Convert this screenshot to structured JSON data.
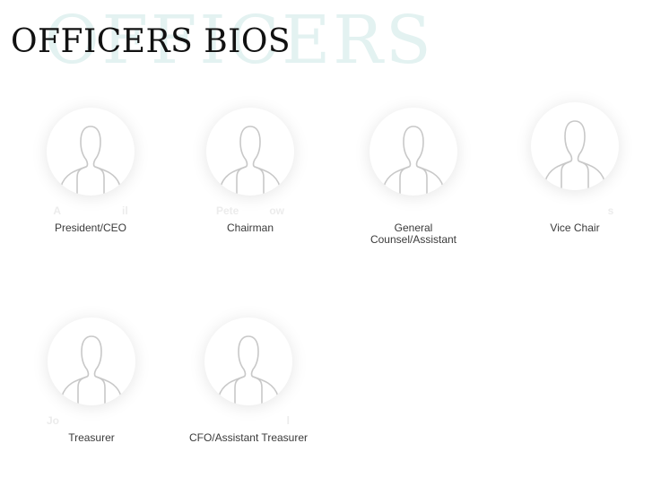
{
  "page": {
    "watermark": "OFFICERS",
    "heading": "OFFICERS BIOS"
  },
  "officers": [
    {
      "name": "A",
      "name_suffix": "il",
      "title": "President/CEO"
    },
    {
      "name": "Pete",
      "name_suffix": "ow",
      "title": "Chairman"
    },
    {
      "name": "",
      "name_suffix": "",
      "title": "General Counsel/Assistant"
    },
    {
      "name": "",
      "name_suffix": "s",
      "title": "Vice Chair"
    },
    {
      "name": "Jo",
      "name_suffix": "",
      "title": "Treasurer"
    },
    {
      "name": "",
      "name_suffix": "l",
      "title": "CFO/Assistant Treasurer"
    }
  ],
  "icons": {
    "avatar": "person-silhouette-icon"
  },
  "colors": {
    "heading": "#111111",
    "watermark": "#e3f2f1",
    "title_text": "#3a3a3a"
  }
}
